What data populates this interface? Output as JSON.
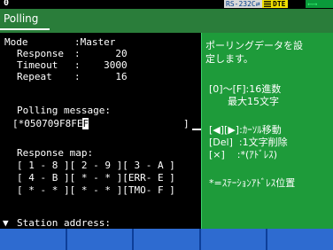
{
  "topbar": {
    "channel": "0",
    "port": "RS-232C",
    "port_arrow": "⇄",
    "dte": "DTE",
    "conn_icon": "⟵⟶"
  },
  "screen": {
    "title": "Polling"
  },
  "settings": {
    "mode_label": "Mode",
    "mode_value": ":Master",
    "response_label": "Response",
    "response_value": ":      20",
    "timeout_label": "Timeout",
    "timeout_value": ":    3000",
    "repeat_label": "Repeat",
    "repeat_value": ":      16"
  },
  "polling": {
    "label": "Polling message:",
    "prefix": "[*050709F8FE",
    "cursor_char": "F",
    "end": "]"
  },
  "response_map": {
    "label": "Response map:",
    "rows": [
      "[ 1 - 8 ][ 2 - 9 ][ 3 - A ]",
      "[ 4 - B ][ * - * ][ERR- E ]",
      "[ * - * ][ * - * ][TMO- F ]"
    ]
  },
  "status": {
    "arrow": "▼",
    "text": "Station address:"
  },
  "info": {
    "line1": "ポーリングデータを設",
    "line2": "定します。",
    "line3": "[0]～[F]:16進数",
    "line4": "      最大15文字",
    "line5": "[◀][▶]:ｶｰｿﾙ移動",
    "line6": "[Del]  :1文字削除",
    "line7": "[×]    :*(ｱﾄﾞﾚｽ)",
    "line8": "*=ｽﾃｰｼｮﾝｱﾄﾞﾚｽ位置"
  },
  "function_keys": [
    "",
    "",
    "",
    "",
    ""
  ]
}
